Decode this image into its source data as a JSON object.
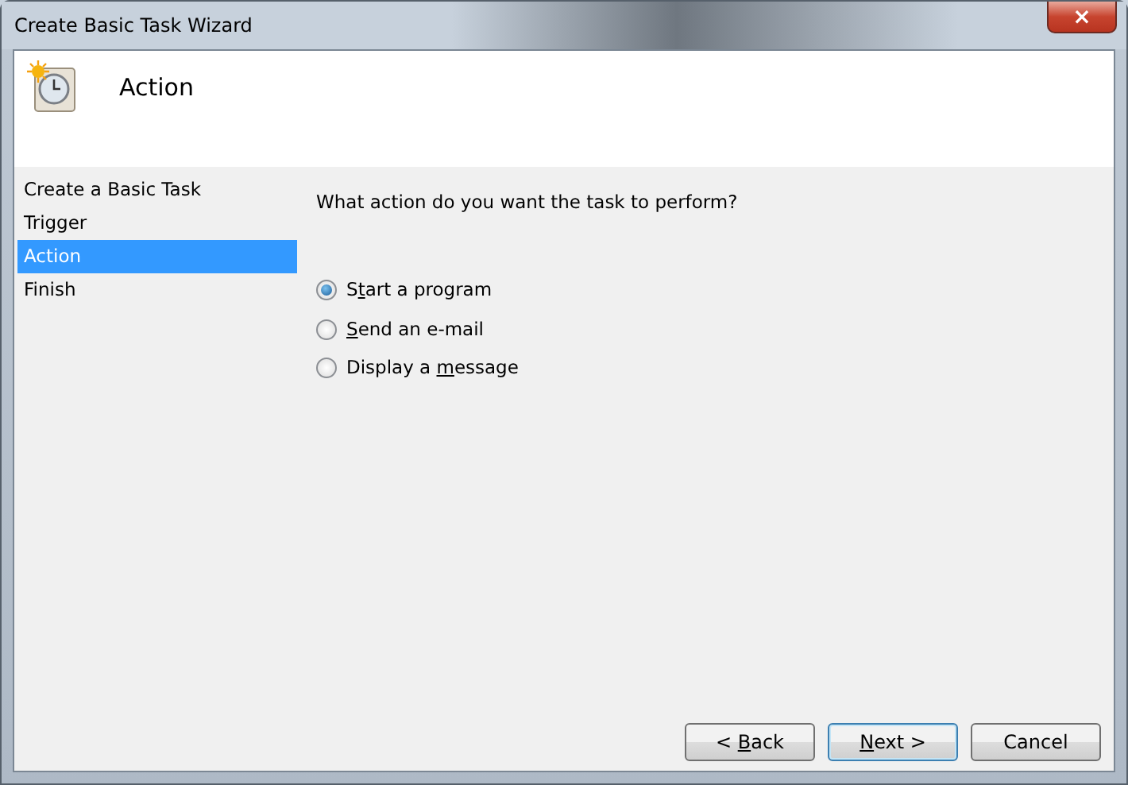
{
  "window": {
    "title": "Create Basic Task Wizard",
    "close": "×"
  },
  "header": {
    "title": "Action"
  },
  "steps": [
    {
      "label": "Create a Basic Task",
      "selected": false
    },
    {
      "label": "Trigger",
      "selected": false
    },
    {
      "label": "Action",
      "selected": true
    },
    {
      "label": "Finish",
      "selected": false
    }
  ],
  "question": "What action do you want the task to perform?",
  "options": [
    {
      "before": "S",
      "key": "t",
      "after": "art a program",
      "selected": true
    },
    {
      "key": "S",
      "after": "end an e-mail",
      "selected": false
    },
    {
      "before": "Display a ",
      "key": "m",
      "after": "essage",
      "selected": false
    }
  ],
  "buttons": [
    {
      "before": "< ",
      "key": "B",
      "after": "ack",
      "default": false
    },
    {
      "key": "N",
      "after": "ext >",
      "default": true
    },
    {
      "before": "Cancel",
      "default": false
    }
  ]
}
